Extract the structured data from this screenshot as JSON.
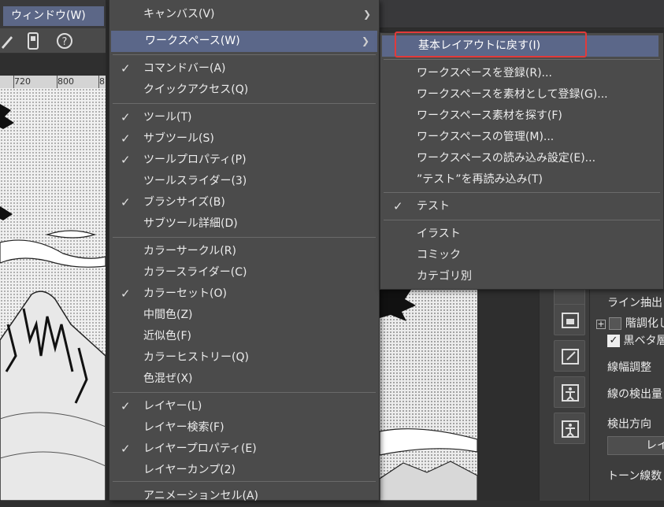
{
  "menubar": {
    "window_label": "ウィンドウ(W)"
  },
  "ruler": {
    "ticks": [
      "720",
      "800",
      "8"
    ]
  },
  "main_menu": {
    "items": [
      {
        "label": "キャンバス(V)",
        "checked": false,
        "submenu": true
      },
      {
        "label": "ワークスペース(W)",
        "checked": false,
        "submenu": true,
        "highlighted": true
      },
      {
        "label": "コマンドバー(A)",
        "checked": true
      },
      {
        "label": "クイックアクセス(Q)",
        "checked": false
      },
      {
        "label": "ツール(T)",
        "checked": true
      },
      {
        "label": "サブツール(S)",
        "checked": true
      },
      {
        "label": "ツールプロパティ(P)",
        "checked": true
      },
      {
        "label": "ツールスライダー(3)",
        "checked": false
      },
      {
        "label": "ブラシサイズ(B)",
        "checked": true
      },
      {
        "label": "サブツール詳細(D)",
        "checked": false
      },
      {
        "label": "カラーサークル(R)",
        "checked": false
      },
      {
        "label": "カラースライダー(C)",
        "checked": false
      },
      {
        "label": "カラーセット(O)",
        "checked": true
      },
      {
        "label": "中間色(Z)",
        "checked": false
      },
      {
        "label": "近似色(F)",
        "checked": false
      },
      {
        "label": "カラーヒストリー(Q)",
        "checked": false
      },
      {
        "label": "色混ぜ(X)",
        "checked": false
      },
      {
        "label": "レイヤー(L)",
        "checked": true
      },
      {
        "label": "レイヤー検索(F)",
        "checked": false
      },
      {
        "label": "レイヤープロパティ(E)",
        "checked": true
      },
      {
        "label": "レイヤーカンプ(2)",
        "checked": false
      },
      {
        "label": "アニメーションセル(A)",
        "checked": false
      }
    ]
  },
  "sub_menu": {
    "items": [
      {
        "label": "基本レイアウトに戻す(I)",
        "highlighted": true
      },
      {
        "label": "ワークスペースを登録(R)..."
      },
      {
        "label": "ワークスペースを素材として登録(G)..."
      },
      {
        "label": "ワークスペース素材を探す(F)"
      },
      {
        "label": "ワークスペースの管理(M)..."
      },
      {
        "label": "ワークスペースの読み込み設定(E)..."
      },
      {
        "label": "”テスト”を再読み込み(T)"
      },
      {
        "label": "テスト",
        "checked": true
      },
      {
        "label": "イラスト"
      },
      {
        "label": "コミック"
      },
      {
        "label": "カテゴリ別"
      }
    ]
  },
  "properties": {
    "line_extract": "ライン抽出",
    "gradation": "階調化し",
    "black_fill": "黒ベタ層",
    "line_width": "線幅調整",
    "line_detect": "線の検出量",
    "detect_dir": "検出方向",
    "detect_dir_value": "レイ",
    "tone_lines": "トーン線数"
  },
  "colors": {
    "highlight": "#5b6789",
    "menu_bg": "#4b4b4b",
    "callout": "#e23a3a"
  }
}
